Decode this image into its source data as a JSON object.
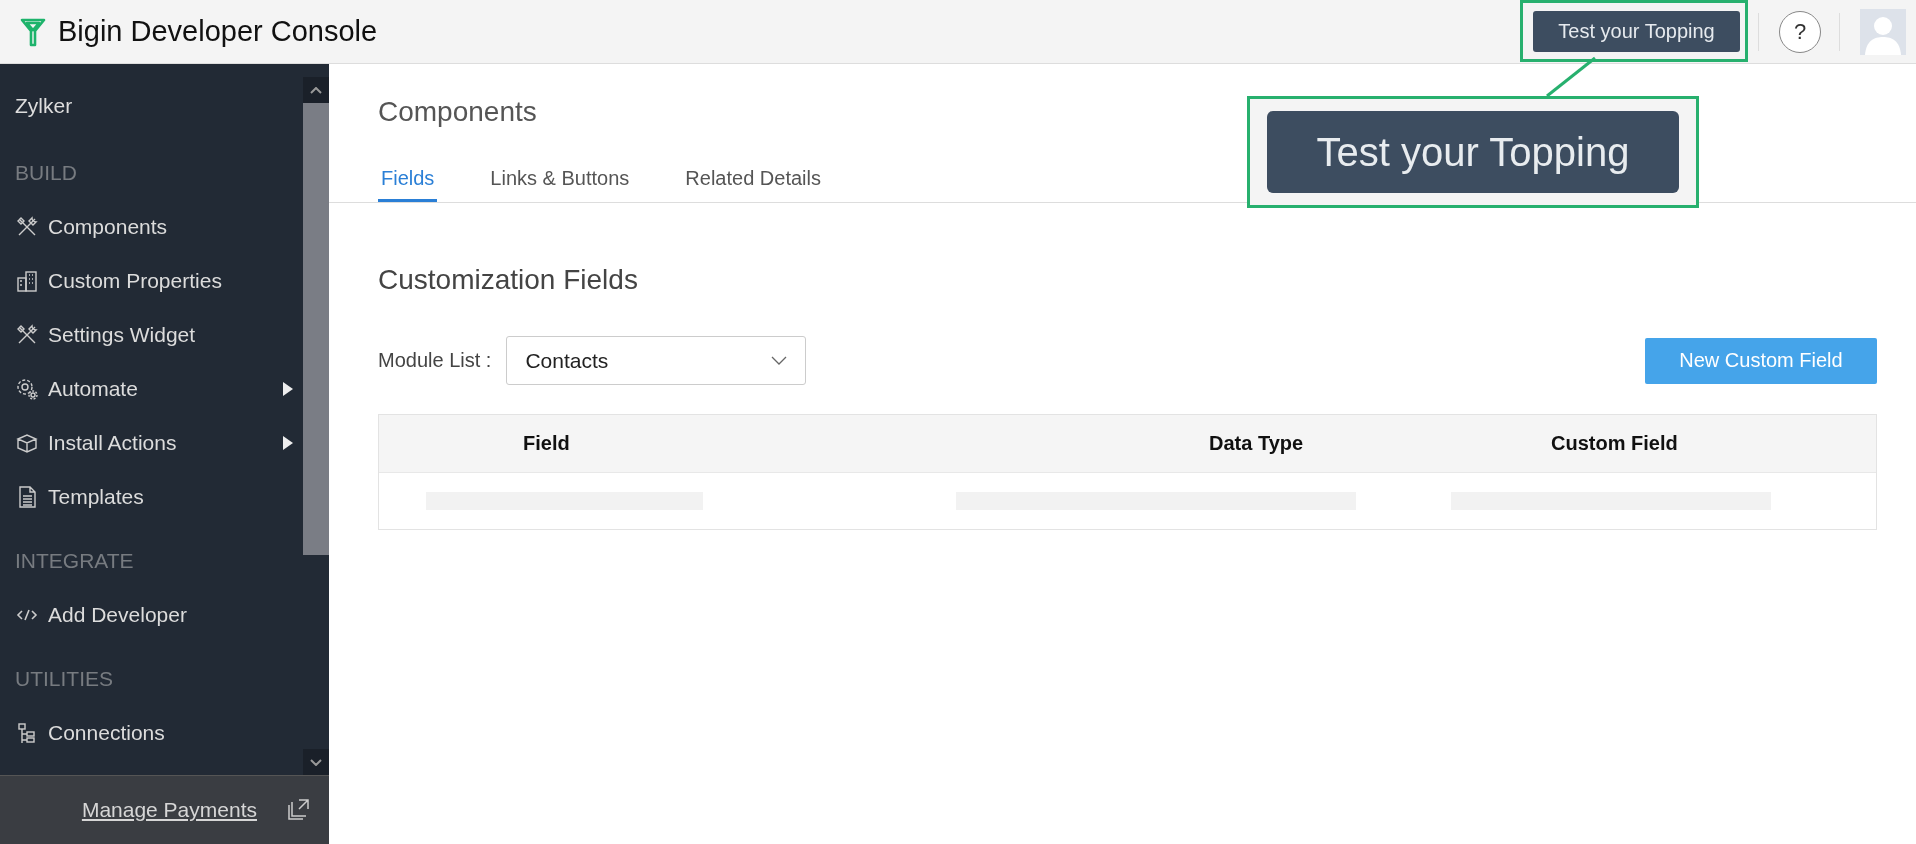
{
  "header": {
    "title": "Bigin Developer Console",
    "test_button": "Test your Topping",
    "help": "?"
  },
  "callout": {
    "label": "Test your Topping"
  },
  "sidebar": {
    "org": "Zylker",
    "items": [
      {
        "kind": "heading",
        "label": "BUILD"
      },
      {
        "kind": "link",
        "label": "Components",
        "has_submenu": false
      },
      {
        "kind": "link",
        "label": "Custom Properties",
        "has_submenu": false
      },
      {
        "kind": "link",
        "label": "Settings Widget",
        "has_submenu": false
      },
      {
        "kind": "link",
        "label": "Automate",
        "has_submenu": true
      },
      {
        "kind": "link",
        "label": "Install Actions",
        "has_submenu": true
      },
      {
        "kind": "link",
        "label": "Templates",
        "has_submenu": false
      },
      {
        "kind": "heading",
        "label": "INTEGRATE"
      },
      {
        "kind": "link",
        "label": "Add Developer",
        "has_submenu": false
      },
      {
        "kind": "heading",
        "label": "UTILITIES"
      },
      {
        "kind": "link",
        "label": "Connections",
        "has_submenu": false
      }
    ],
    "footer_link": "Manage Payments"
  },
  "page": {
    "title": "Components",
    "tabs": [
      {
        "label": "Fields",
        "selected": true
      },
      {
        "label": "Links & Buttons",
        "selected": false
      },
      {
        "label": "Related Details",
        "selected": false
      }
    ],
    "section_title": "Customization Fields",
    "module_label": "Module List :",
    "module_value": "Contacts",
    "new_button": "New Custom Field"
  },
  "table": {
    "columns": [
      "Field",
      "Data Type",
      "Custom Field"
    ],
    "rows": [
      {
        "kind": "skeleton"
      }
    ]
  }
}
